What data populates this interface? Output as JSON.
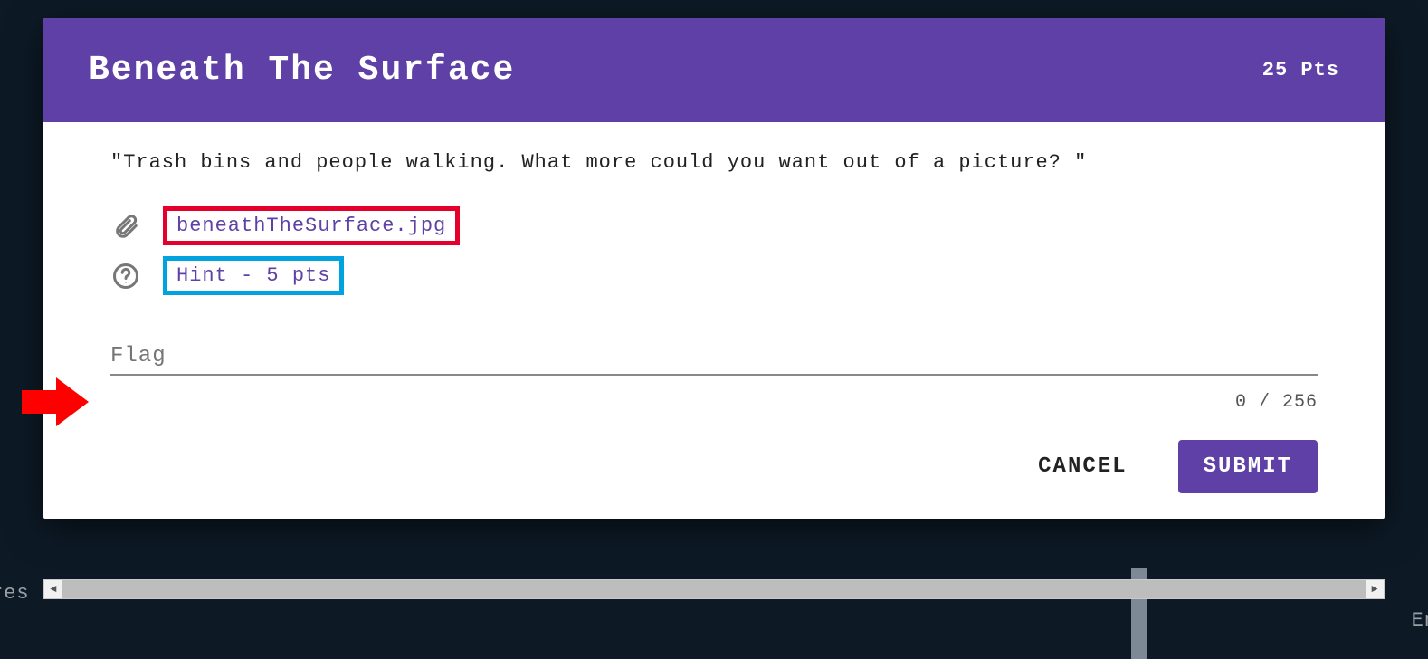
{
  "header": {
    "title": "Beneath The Surface",
    "points_label": "25 Pts"
  },
  "body": {
    "prompt": "\"Trash bins and people walking. What more could you want out of a picture? \"",
    "attachment_label": "beneathTheSurface.jpg",
    "hint_label": "Hint - 5 pts",
    "flag_placeholder": "Flag",
    "counter": "0 / 256"
  },
  "actions": {
    "cancel": "CANCEL",
    "submit": "SUBMIT"
  },
  "background": {
    "left_text": "res",
    "right_text": "En"
  },
  "annotation": {
    "arrow_points_to": "flag-input"
  }
}
